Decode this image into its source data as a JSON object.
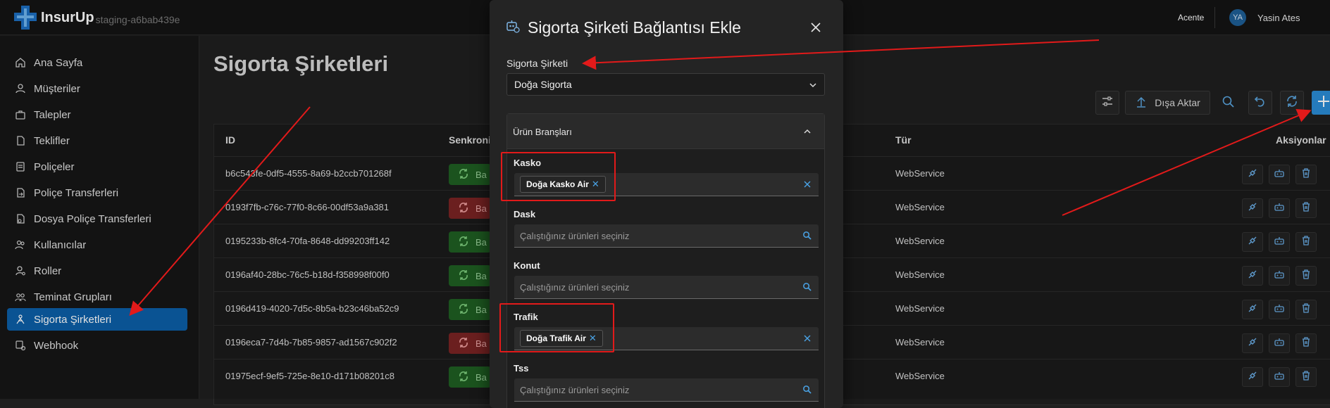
{
  "app": {
    "brand": "InsurUp",
    "env": "staging-a6bab439e",
    "role": "Acente",
    "user_initials": "YA",
    "user_name": "Yasin Ates"
  },
  "sidebar": {
    "items": [
      {
        "label": "Ana Sayfa",
        "icon": "home-icon"
      },
      {
        "label": "Müşteriler",
        "icon": "user-icon"
      },
      {
        "label": "Talepler",
        "icon": "briefcase-icon"
      },
      {
        "label": "Teklifler",
        "icon": "document-icon"
      },
      {
        "label": "Poliçeler",
        "icon": "policy-icon"
      },
      {
        "label": "Poliçe Transferleri",
        "icon": "transfer-icon"
      },
      {
        "label": "Dosya Poliçe Transferleri",
        "icon": "file-transfer-icon"
      },
      {
        "label": "Kullanıcılar",
        "icon": "users-icon"
      },
      {
        "label": "Roller",
        "icon": "roles-icon"
      },
      {
        "label": "Teminat Grupları",
        "icon": "groups-icon"
      },
      {
        "label": "Sigorta Şirketleri",
        "icon": "insurance-icon",
        "active": true
      },
      {
        "label": "Webhook",
        "icon": "webhook-icon"
      }
    ]
  },
  "page": {
    "title": "Sigorta Şirketleri",
    "export_label": "Dışa Aktar"
  },
  "table": {
    "headers": {
      "id": "ID",
      "sync": "Senkroniz",
      "type": "Tür",
      "actions": "Aksiyonlar"
    },
    "rows": [
      {
        "id": "b6c543fe-0df5-4555-8a69-b2ccb701268f",
        "sync": "ok",
        "sync_label": "Ba",
        "type": "WebService"
      },
      {
        "id": "0193f7fb-c76c-77f0-8c66-00df53a9a381",
        "sync": "bad",
        "sync_label": "Ba",
        "type": "WebService"
      },
      {
        "id": "0195233b-8fc4-70fa-8648-dd99203ff142",
        "sync": "ok",
        "sync_label": "Ba",
        "type": "WebService"
      },
      {
        "id": "0196af40-28bc-76c5-b18d-f358998f00f0",
        "sync": "ok",
        "sync_label": "Ba",
        "type": "WebService"
      },
      {
        "id": "0196d419-4020-7d5c-8b5a-b23c46ba52c9",
        "sync": "ok",
        "sync_label": "Ba",
        "type": "WebService"
      },
      {
        "id": "0196eca7-7d4b-7b85-9857-ad1567c902f2",
        "sync": "bad",
        "sync_label": "Ba",
        "type": "WebService"
      },
      {
        "id": "01975ecf-9ef5-725e-8e10-d171b08201c8",
        "sync": "ok",
        "sync_label": "Ba",
        "type": "WebService"
      }
    ]
  },
  "modal": {
    "title": "Sigorta Şirketi Bağlantısı Ekle",
    "company_label": "Sigorta Şirketi",
    "company_value": "Doğa Sigorta",
    "branches_title": "Ürün Branşları",
    "fields": [
      {
        "label": "Kasko",
        "chip": "Doğa Kasko Air",
        "placeholder": ""
      },
      {
        "label": "Dask",
        "chip": "",
        "placeholder": "Çalıştığınız ürünleri seçiniz"
      },
      {
        "label": "Konut",
        "chip": "",
        "placeholder": "Çalıştığınız ürünleri seçiniz"
      },
      {
        "label": "Trafik",
        "chip": "Doğa Trafik Air",
        "placeholder": ""
      },
      {
        "label": "Tss",
        "chip": "",
        "placeholder": "Çalıştığınız ürünleri seçiniz"
      }
    ]
  },
  "colors": {
    "accent": "#2b8dd6",
    "active_nav": "#0c5fa8",
    "sync_ok": "#1f5f23",
    "sync_bad": "#7a2424",
    "annotation": "#e21a1a"
  }
}
